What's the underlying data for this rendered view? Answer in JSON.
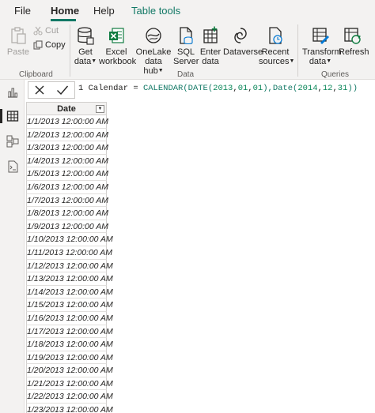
{
  "tabs": {
    "file": "File",
    "home": "Home",
    "help": "Help",
    "table_tools": "Table tools"
  },
  "ribbon": {
    "paste": "Paste",
    "cut": "Cut",
    "copy": "Copy",
    "clipboard_group": "Clipboard",
    "get_data_1": "Get",
    "get_data_2": "data",
    "excel_1": "Excel",
    "excel_2": "workbook",
    "onelake_1": "OneLake",
    "onelake_2": "data hub",
    "sql_1": "SQL",
    "sql_2": "Server",
    "enter_1": "Enter",
    "enter_2": "data",
    "dataverse": "Dataverse",
    "recent_1": "Recent",
    "recent_2": "sources",
    "data_group": "Data",
    "transform_1": "Transform",
    "transform_2": "data",
    "refresh": "Refresh",
    "queries_group": "Queries"
  },
  "formula_bar": {
    "line_number": "1",
    "parts": {
      "a": "Calendar = ",
      "b": "CALENDAR(DATE(",
      "c": "2013",
      "d": ",",
      "e": "01",
      "f": ",",
      "g": "01",
      "h": "),Date(",
      "i": "2014",
      "j": ",",
      "k": "12",
      "l": ",",
      "m": "31",
      "n": "))"
    }
  },
  "table": {
    "column_header": "Date",
    "rows": [
      "1/1/2013 12:00:00 AM",
      "1/2/2013 12:00:00 AM",
      "1/3/2013 12:00:00 AM",
      "1/4/2013 12:00:00 AM",
      "1/5/2013 12:00:00 AM",
      "1/6/2013 12:00:00 AM",
      "1/7/2013 12:00:00 AM",
      "1/8/2013 12:00:00 AM",
      "1/9/2013 12:00:00 AM",
      "1/10/2013 12:00:00 AM",
      "1/11/2013 12:00:00 AM",
      "1/12/2013 12:00:00 AM",
      "1/13/2013 12:00:00 AM",
      "1/14/2013 12:00:00 AM",
      "1/15/2013 12:00:00 AM",
      "1/16/2013 12:00:00 AM",
      "1/17/2013 12:00:00 AM",
      "1/18/2013 12:00:00 AM",
      "1/19/2013 12:00:00 AM",
      "1/20/2013 12:00:00 AM",
      "1/21/2013 12:00:00 AM",
      "1/22/2013 12:00:00 AM",
      "1/23/2013 12:00:00 AM"
    ]
  },
  "colors": {
    "accent": "#117865",
    "ribbon_bg": "#f3f2f1",
    "excel_green": "#107c41",
    "blue_icon": "#0078d4"
  },
  "icons": {
    "paste": "clipboard-icon",
    "cut": "scissors-icon",
    "copy": "copy-icon",
    "get_data": "database-icon",
    "excel": "excel-icon",
    "onelake": "onelake-icon",
    "sql": "sql-server-icon",
    "enter_data": "table-plus-icon",
    "dataverse": "dataverse-icon",
    "recent": "recent-sources-icon",
    "transform": "transform-icon",
    "refresh": "refresh-icon",
    "report_view": "bar-chart-icon",
    "table_view": "table-icon",
    "model_view": "model-icon",
    "dax_view": "dax-query-icon"
  }
}
